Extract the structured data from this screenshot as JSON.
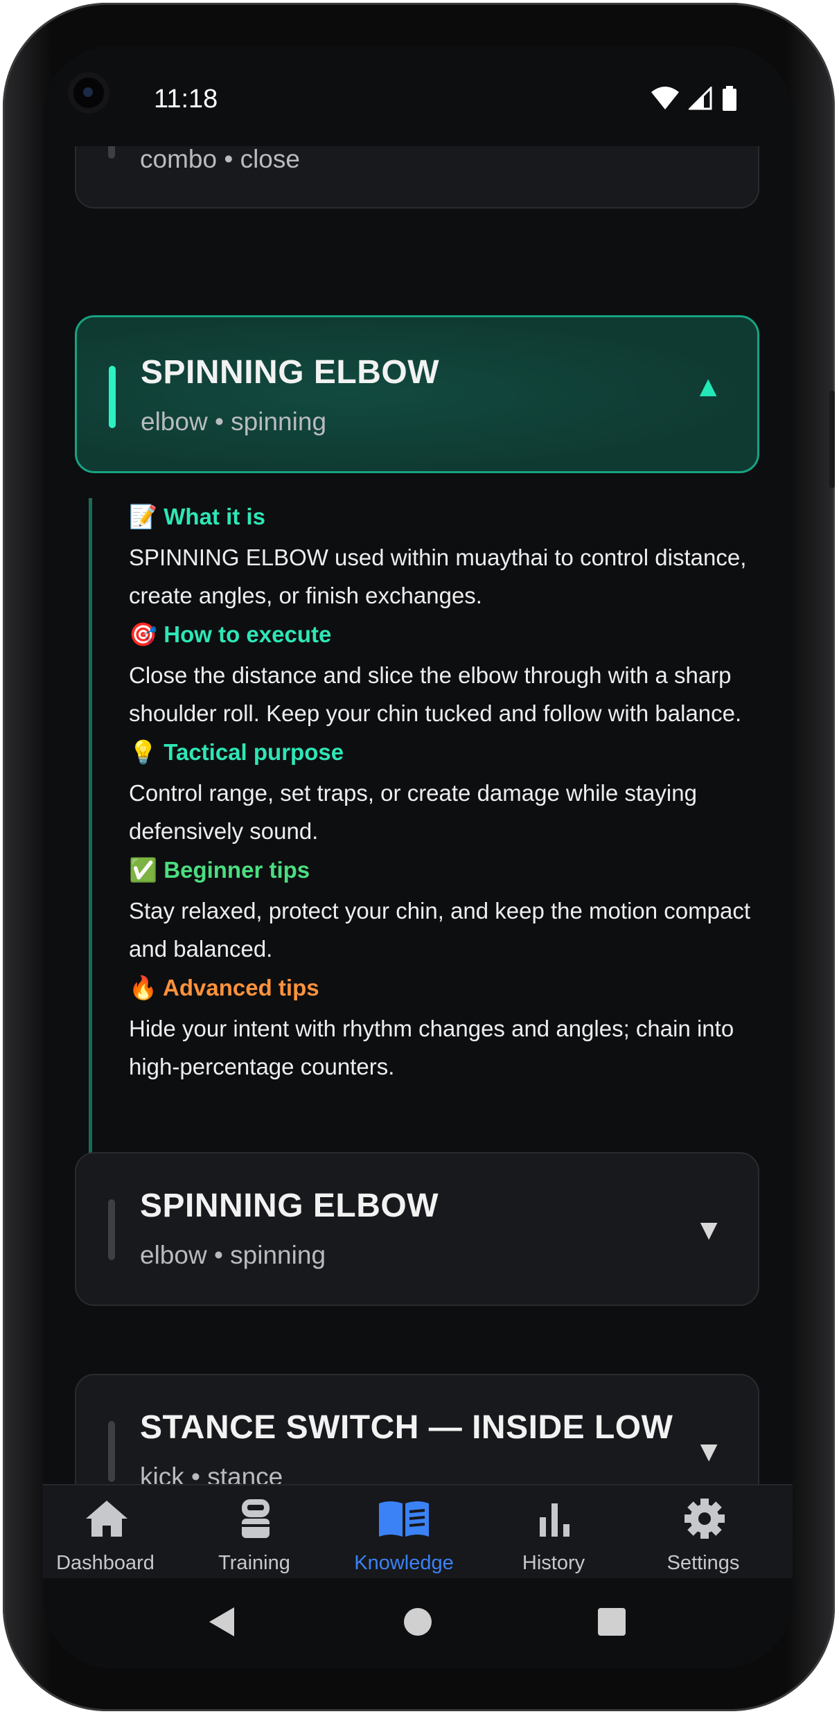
{
  "status_bar": {
    "time": "11:18"
  },
  "top_card": {
    "subtitle": "combo • close"
  },
  "expanded_card": {
    "title": "SPINNING ELBOW",
    "subtitle": "elbow • spinning",
    "sections": [
      {
        "emoji": "📝",
        "heading": "What it is",
        "text": "SPINNING ELBOW used within muaythai to control distance, create angles, or finish exchanges."
      },
      {
        "emoji": "🎯",
        "heading": "How to execute",
        "text": "Close the distance and slice the elbow through with a sharp shoulder roll. Keep your chin tucked and follow with balance."
      },
      {
        "emoji": "💡",
        "heading": "Tactical purpose",
        "text": "Control range, set traps, or create damage while staying defensively sound."
      },
      {
        "emoji": "✅",
        "heading": "Beginner tips",
        "text": "Stay relaxed, protect your chin, and keep the motion compact and balanced."
      },
      {
        "emoji": "🔥",
        "heading": "Advanced tips",
        "text": "Hide your intent with rhythm changes and angles; chain into high-percentage counters."
      }
    ],
    "colors": {
      "heading_teal": "#2ee6b6",
      "heading_green": "#4ade80",
      "heading_orange": "#fb923c"
    }
  },
  "cards": [
    {
      "title": "SPINNING ELBOW",
      "subtitle": "elbow • spinning"
    },
    {
      "title": "STANCE SWITCH — INSIDE LOW",
      "subtitle": "kick • stance"
    }
  ],
  "nav": {
    "items": [
      {
        "label": "Dashboard",
        "icon": "home-icon"
      },
      {
        "label": "Training",
        "icon": "training-icon"
      },
      {
        "label": "Knowledge",
        "icon": "book-icon",
        "active": true
      },
      {
        "label": "History",
        "icon": "bar-chart-icon"
      },
      {
        "label": "Settings",
        "icon": "gear-icon"
      }
    ],
    "active_color": "#3b82f6"
  },
  "system_nav": {
    "icons": [
      "back-icon",
      "home-circle-icon",
      "recents-icon"
    ]
  }
}
